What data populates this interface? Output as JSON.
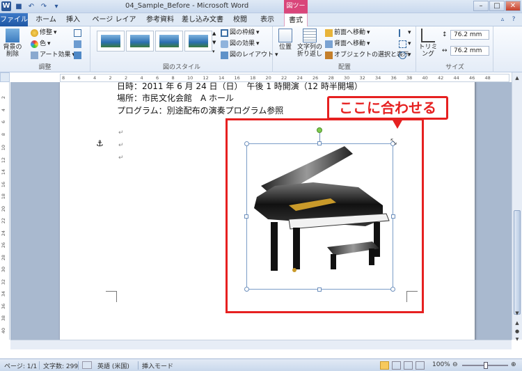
{
  "titlebar": {
    "app_icon": "W",
    "title": "04_Sample_Before - Microsoft Word",
    "contextual_tab": "図ツール",
    "window_buttons": [
      "–",
      "□",
      "✕"
    ]
  },
  "tabs": {
    "file": "ファイル",
    "home": "ホーム",
    "insert": "挿入",
    "page_layout": "ページ レイアウト",
    "references": "参考資料",
    "mailings": "差し込み文書",
    "review": "校閲",
    "view": "表示",
    "format": "書式"
  },
  "ribbon": {
    "adjust": {
      "label": "調整",
      "remove_bg": "背景の削除",
      "corrections": "修整",
      "color": "色",
      "artistic": "アート効果"
    },
    "styles": {
      "label": "図のスタイル",
      "border": "図の枠線",
      "effects": "図の効果",
      "layout": "図のレイアウト"
    },
    "arrange": {
      "label": "配置",
      "position": "位置",
      "wrap": "文字列の折り返し",
      "bring_forward": "前面へ移動",
      "send_backward": "背面へ移動",
      "selection_pane": "オブジェクトの選択と表示"
    },
    "size": {
      "label": "サイズ",
      "crop": "トリミング",
      "height": "76.2 mm",
      "width": "76.2 mm"
    }
  },
  "ruler": {
    "h_marks": [
      "8",
      "6",
      "4",
      "2",
      "2",
      "4",
      "6",
      "8",
      "10",
      "12",
      "14",
      "16",
      "18",
      "20",
      "22",
      "24",
      "26",
      "28",
      "30",
      "32",
      "34",
      "36",
      "38",
      "40",
      "42",
      "44",
      "46",
      "48"
    ],
    "v_marks": [
      "2",
      "4",
      "6",
      "8",
      "10",
      "12",
      "14",
      "16",
      "18",
      "20",
      "22",
      "24",
      "26",
      "28",
      "30",
      "32",
      "34",
      "36",
      "38",
      "40"
    ]
  },
  "document": {
    "line_top": "日時：2011 年 6 月 24 日（日）　午後 1 時開演（12 時半開場）",
    "line_venue": "場所：市民文化会館　A ホール",
    "line_program": "プログラム：別途配布の演奏プログラム参照",
    "para_mark": "↵",
    "anchor": "⚓"
  },
  "callout": {
    "text": "ここに合わせる"
  },
  "statusbar": {
    "page": "ページ: 1/1",
    "words": "文字数: 299",
    "language": "英語 (米国)",
    "mode": "挿入モード",
    "zoom": "100%"
  }
}
